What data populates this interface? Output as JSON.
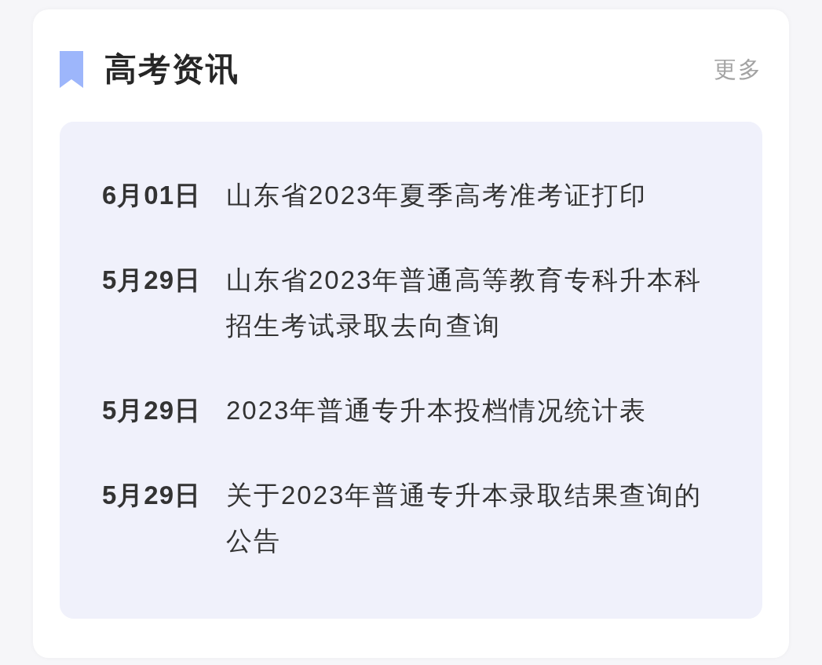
{
  "header": {
    "title": "高考资讯",
    "more": "更多"
  },
  "news": [
    {
      "date": "6月01日",
      "title": "山东省2023年夏季高考准考证打印"
    },
    {
      "date": "5月29日",
      "title": "山东省2023年普通高等教育专科升本科招生考试录取去向查询"
    },
    {
      "date": "5月29日",
      "title": "2023年普通专升本投档情况统计表"
    },
    {
      "date": "5月29日",
      "title": "关于2023年普通专升本录取结果查询的公告"
    }
  ]
}
